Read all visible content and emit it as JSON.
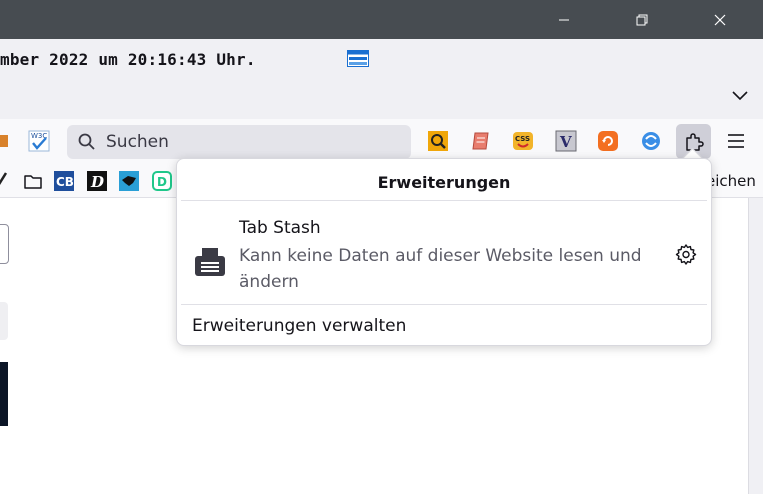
{
  "window": {
    "minimize_icon": "minimize-icon",
    "maximize_icon": "restore-icon",
    "close_icon": "close-icon"
  },
  "infobar": {
    "status_text": "mber 2022 um 20:16:43 Uhr."
  },
  "toolbar": {
    "search_placeholder": "Suchen"
  },
  "bookmarks": {
    "other_label": "eichen"
  },
  "extensions_panel": {
    "title": "Erweiterungen",
    "items": [
      {
        "name": "Tab Stash",
        "description": "Kann keine Daten auf dieser Website lesen und ändern",
        "icon": "tab-stash-icon"
      }
    ],
    "manage_label": "Erweiterungen verwalten"
  },
  "colors": {
    "titlebar": "#474c51",
    "toolbar": "#f9f9fb",
    "panel_bg": "#ffffff",
    "puzzle_active": "#cfcfd8"
  }
}
